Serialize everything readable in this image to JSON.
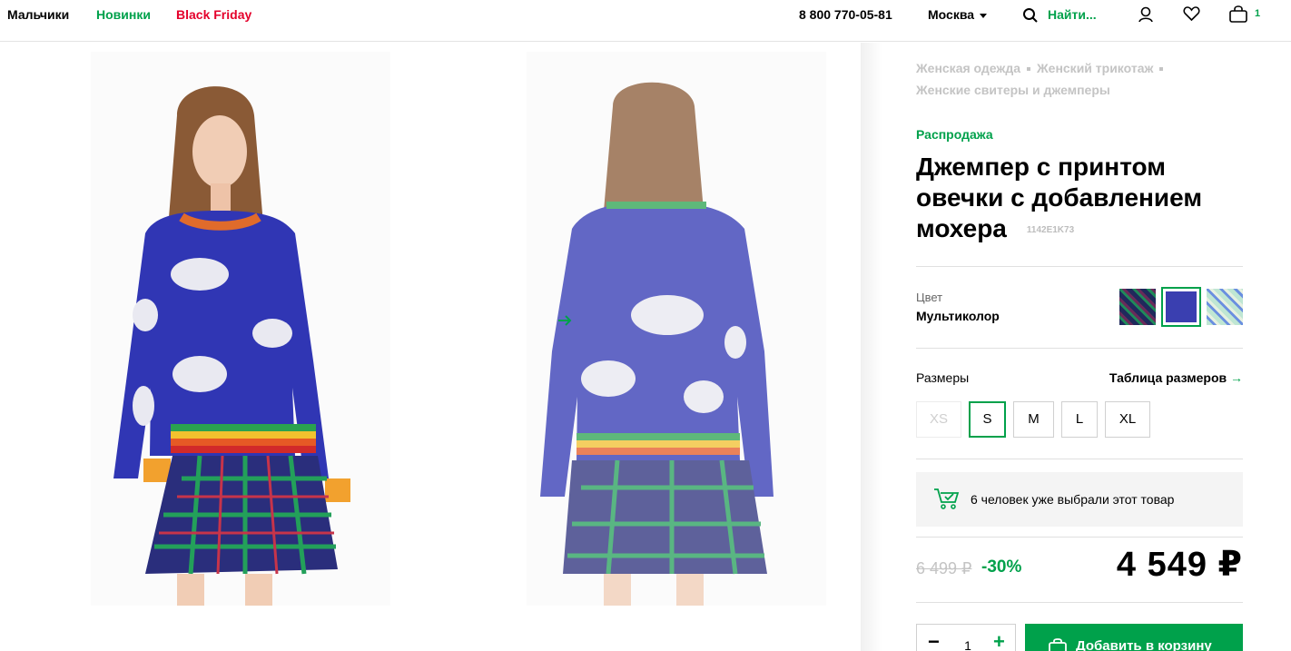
{
  "header": {
    "nav": [
      {
        "label": "Мальчики"
      },
      {
        "label": "Новинки"
      },
      {
        "label": "Black Friday"
      }
    ],
    "phone": "8 800 770-05-81",
    "city": "Москва",
    "search_placeholder": "Найти...",
    "cart_count": "1"
  },
  "breadcrumbs": [
    "Женская одежда",
    "Женский трикотаж",
    "Женские свитеры и джемперы"
  ],
  "product": {
    "sale_label": "Распродажа",
    "title": "Джемпер с принтом овечки с добавлением мохера",
    "sku": "1142E1K73",
    "color_label": "Цвет",
    "color_value": "Мультиколор",
    "swatches": [
      {
        "name": "dark-plaid",
        "color": "#1f2a5c"
      },
      {
        "name": "blue",
        "color": "#3a3fb0"
      },
      {
        "name": "light-plaid",
        "color": "#bfe6d3"
      }
    ],
    "sizes_label": "Размеры",
    "size_table_link": "Таблица размеров",
    "sizes": [
      {
        "label": "XS",
        "state": "disabled"
      },
      {
        "label": "S",
        "state": "selected"
      },
      {
        "label": "M",
        "state": "available"
      },
      {
        "label": "L",
        "state": "available"
      },
      {
        "label": "XL",
        "state": "available"
      }
    ],
    "social_proof": "6 человек уже выбрали этот товар",
    "old_price": "6 499 ₽",
    "discount": "-30%",
    "price": "4 549 ₽",
    "quantity": "1",
    "add_to_cart": "Добавить в корзину"
  },
  "colors": {
    "accent": "#00a14b",
    "black_friday": "#e4002b",
    "muted": "#c4c4c4"
  }
}
